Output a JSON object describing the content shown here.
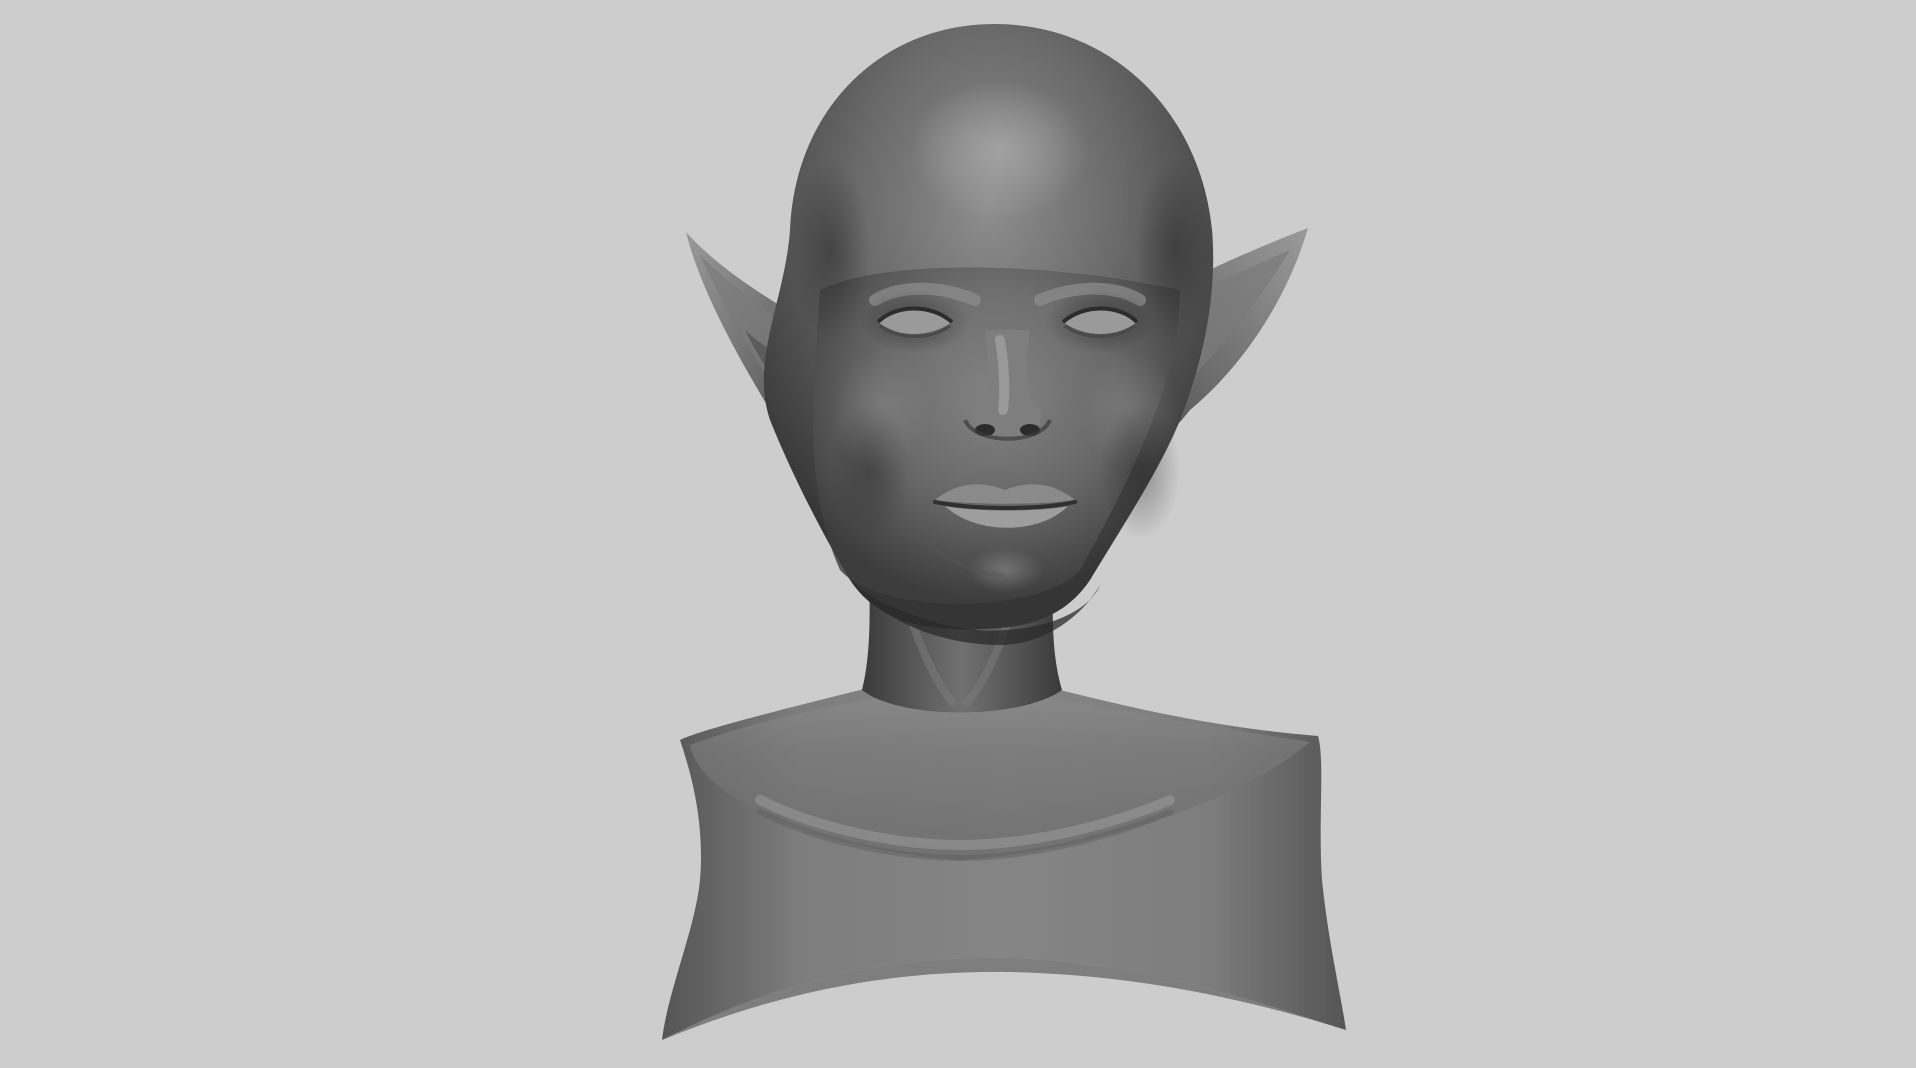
{
  "viewport": {
    "background_color": "#cdcdcd",
    "subject": "sculpt-bust",
    "material_colors": {
      "base": "#6b6b6b",
      "highlight": "#9a9a9a",
      "shadow": "#2e2e2e"
    }
  }
}
